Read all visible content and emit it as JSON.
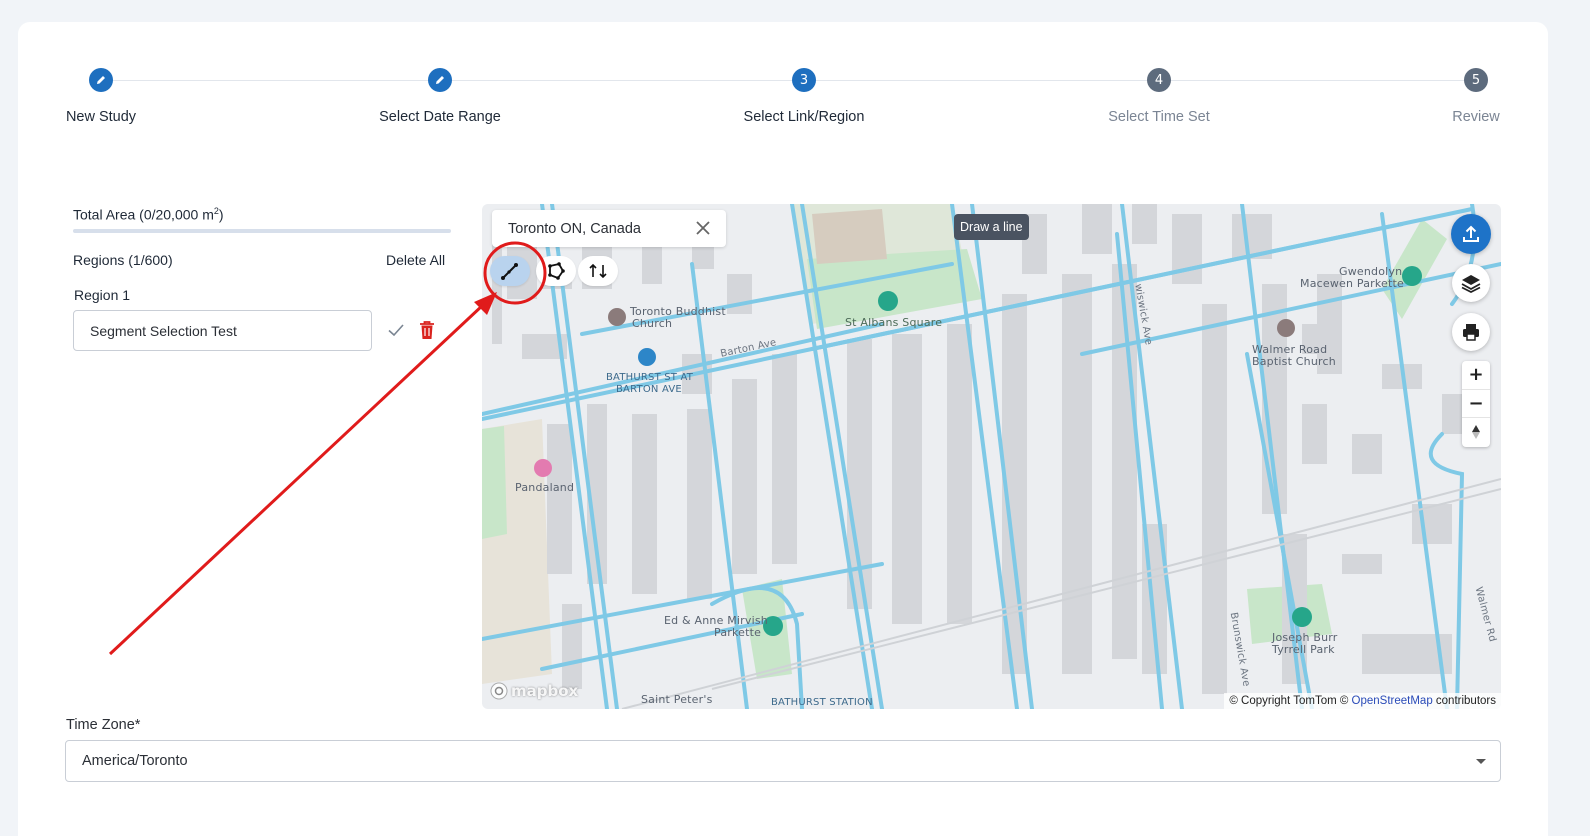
{
  "stepper": {
    "steps": [
      {
        "label": "New Study",
        "marker": "edit-icon",
        "state": "done"
      },
      {
        "label": "Select Date Range",
        "marker": "edit-icon",
        "state": "done"
      },
      {
        "label": "Select Link/Region",
        "marker": "3",
        "state": "active"
      },
      {
        "label": "Select Time Set",
        "marker": "4",
        "state": "pending"
      },
      {
        "label": "Review",
        "marker": "5",
        "state": "pending"
      }
    ]
  },
  "panel": {
    "total_area_label": "Total Area (0/20,000 m",
    "total_area_exp": "2",
    "total_area_close": ")",
    "regions_label": "Regions (1/600)",
    "delete_all": "Delete All",
    "region_label": "Region 1",
    "region_name_value": "Segment Selection Test"
  },
  "map": {
    "search_value": "Toronto ON, Canada",
    "tooltip": "Draw a line",
    "labels": {
      "buddhist_church_1": "Toronto Buddhist",
      "buddhist_church_2": "Church",
      "barton_ave": "Barton Ave",
      "bathurst_stop_1": "BATHURST ST AT",
      "bathurst_stop_2": "BARTON AVE",
      "st_albans": "St Albans Square",
      "pandaland": "Pandaland",
      "mirvish_1": "Ed & Anne Mirvish",
      "mirvish_2": "Parkette",
      "saint_peters": "Saint Peter's",
      "bathurst_station": "BATHURST STATION",
      "gwendolyn_1": "Gwendolyn",
      "gwendolyn_2": "Macewen Parkette",
      "walmer_1": "Walmer Road",
      "walmer_2": "Baptist Church",
      "joseph_1": "Joseph Burr",
      "joseph_2": "Tyrrell Park",
      "brunswick_ave": "Brunswick Ave",
      "walmer_rd": "Walmer Rd",
      "wiswick_ave": "wiswick Ave"
    },
    "logo": "mapbox",
    "attribution_prefix": "© Copyright TomTom © ",
    "attribution_link": "OpenStreetMap",
    "attribution_suffix": " contributors"
  },
  "timezone": {
    "label": "Time Zone*",
    "value": "America/Toronto"
  },
  "colors": {
    "accent": "#1e6fbf",
    "road": "#7fc9e6",
    "annotation": "#e01b1b"
  }
}
